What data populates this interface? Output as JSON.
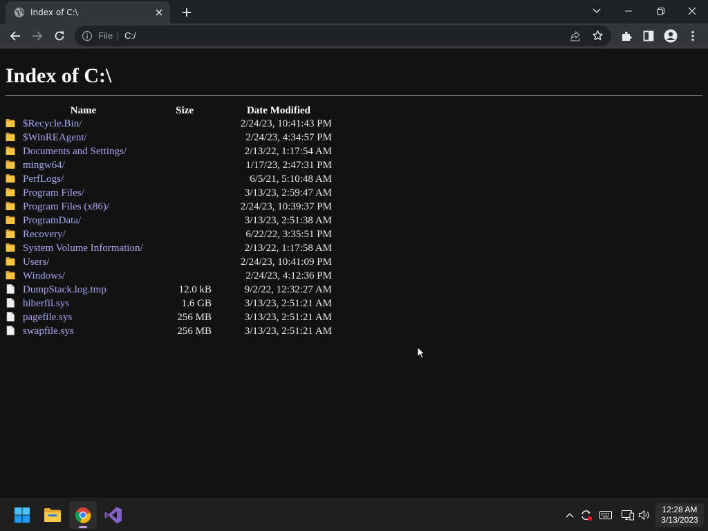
{
  "browser": {
    "tab_title": "Index of C:\\",
    "omnibox": {
      "scheme": "File",
      "url": "C:/"
    }
  },
  "page": {
    "heading": "Index of C:\\",
    "columns": {
      "name": "Name",
      "size": "Size",
      "date": "Date Modified"
    },
    "entries": [
      {
        "type": "folder",
        "name": "$Recycle.Bin/",
        "size": "",
        "date": "2/24/23, 10:41:43 PM"
      },
      {
        "type": "folder",
        "name": "$WinREAgent/",
        "size": "",
        "date": "2/24/23, 4:34:57 PM"
      },
      {
        "type": "folder",
        "name": "Documents and Settings/",
        "size": "",
        "date": "2/13/22, 1:17:54 AM"
      },
      {
        "type": "folder",
        "name": "mingw64/",
        "size": "",
        "date": "1/17/23, 2:47:31 PM"
      },
      {
        "type": "folder",
        "name": "PerfLogs/",
        "size": "",
        "date": "6/5/21, 5:10:48 AM"
      },
      {
        "type": "folder",
        "name": "Program Files/",
        "size": "",
        "date": "3/13/23, 2:59:47 AM"
      },
      {
        "type": "folder",
        "name": "Program Files (x86)/",
        "size": "",
        "date": "2/24/23, 10:39:37 PM"
      },
      {
        "type": "folder",
        "name": "ProgramData/",
        "size": "",
        "date": "3/13/23, 2:51:38 AM"
      },
      {
        "type": "folder",
        "name": "Recovery/",
        "size": "",
        "date": "6/22/22, 3:35:51 PM"
      },
      {
        "type": "folder",
        "name": "System Volume Information/",
        "size": "",
        "date": "2/13/22, 1:17:58 AM"
      },
      {
        "type": "folder",
        "name": "Users/",
        "size": "",
        "date": "2/24/23, 10:41:09 PM"
      },
      {
        "type": "folder",
        "name": "Windows/",
        "size": "",
        "date": "2/24/23, 4:12:36 PM"
      },
      {
        "type": "file",
        "name": "DumpStack.log.tmp",
        "size": "12.0 kB",
        "date": "9/2/22, 12:32:27 AM"
      },
      {
        "type": "file",
        "name": "hiberfil.sys",
        "size": "1.6 GB",
        "date": "3/13/23, 2:51:21 AM"
      },
      {
        "type": "file",
        "name": "pagefile.sys",
        "size": "256 MB",
        "date": "3/13/23, 2:51:21 AM"
      },
      {
        "type": "file",
        "name": "swapfile.sys",
        "size": "256 MB",
        "date": "3/13/23, 2:51:21 AM"
      }
    ]
  },
  "taskbar": {
    "apps": [
      "start-icon",
      "file-explorer-icon",
      "chrome-icon",
      "visual-studio-icon"
    ],
    "clock": {
      "time": "12:28 AM",
      "date": "3/13/2023"
    }
  },
  "colors": {
    "link": "#a8a7f2",
    "folder": "#f5c542",
    "background": "#121212",
    "taskbar_indicator": "#c39ee8"
  }
}
